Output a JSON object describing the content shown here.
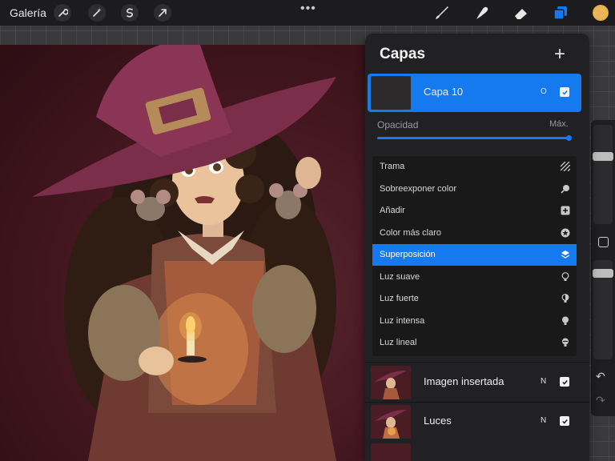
{
  "topbar": {
    "gallery_label": "Galería",
    "left_tools": [
      "wrench-icon",
      "magic-wand-icon",
      "selection-icon",
      "transform-arrow-icon"
    ],
    "more_label": "•••",
    "right_tools": [
      "brush-icon",
      "smudge-icon",
      "eraser-icon",
      "layers-icon"
    ],
    "active_color": "#e9b556"
  },
  "layers_panel": {
    "title": "Capas",
    "add_label": "+",
    "active_layer": {
      "name": "Capa 10",
      "blend_letter": "O",
      "visible": true
    },
    "opacity": {
      "label": "Opacidad",
      "max_label": "Máx.",
      "value_percent": 100
    },
    "blend_modes": [
      {
        "label": "Trama",
        "icon": "hatch-icon"
      },
      {
        "label": "Sobreexponer color",
        "icon": "dodge-icon"
      },
      {
        "label": "Añadir",
        "icon": "add-square-icon"
      },
      {
        "label": "Color más claro",
        "icon": "lighter-color-icon"
      },
      {
        "label": "Superposición",
        "icon": "layers-overlay-icon",
        "selected": true
      },
      {
        "label": "Luz suave",
        "icon": "bulb-outline-icon"
      },
      {
        "label": "Luz fuerte",
        "icon": "bulb-half-icon"
      },
      {
        "label": "Luz intensa",
        "icon": "bulb-filled-icon"
      },
      {
        "label": "Luz lineal",
        "icon": "bulb-line-icon"
      }
    ],
    "other_layers": [
      {
        "name": "Imagen insertada",
        "blend_letter": "N",
        "visible": true
      },
      {
        "name": "Luces",
        "blend_letter": "N",
        "visible": true
      }
    ]
  },
  "colors": {
    "accent": "#1579f0",
    "panel_bg": "#212123",
    "topbar_bg": "#1c1c1e"
  }
}
